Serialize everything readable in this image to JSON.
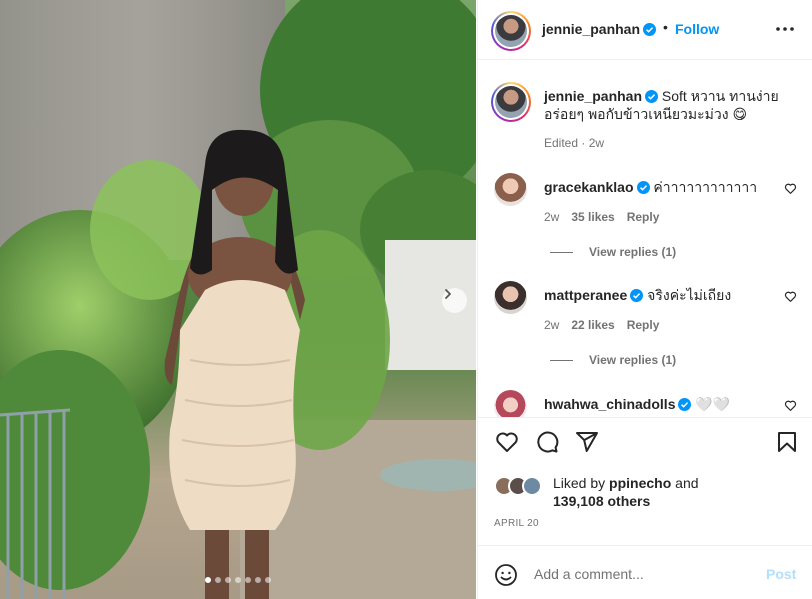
{
  "post": {
    "username": "jennie_panhan",
    "follow_label": "Follow",
    "separator": "•",
    "caption": "Soft หวาน ทานง่าย อร่อยๆ พอกับข้าวเหนียวมะม่วง 😋",
    "caption_meta": "Edited · 2w"
  },
  "comments": [
    {
      "username": "gracekanklao",
      "text": "ค่าาาาาาาาาาาา",
      "time": "2w",
      "likes": "35 likes",
      "reply": "Reply",
      "view_replies": "View replies (1)"
    },
    {
      "username": "mattperanee",
      "text": "จริงค่ะไม่เถียง",
      "time": "2w",
      "likes": "22 likes",
      "reply": "Reply",
      "view_replies": "View replies (1)"
    },
    {
      "username": "hwahwa_chinadolls",
      "text": "🤍🤍"
    }
  ],
  "likes": {
    "prefix": "Liked by ",
    "user": "ppinecho",
    "and": " and",
    "others": "139,108 others"
  },
  "date": "APRIL 20",
  "add_comment": {
    "placeholder": "Add a comment...",
    "post_label": "Post"
  },
  "carousel": {
    "slides": 7,
    "active": 1
  },
  "colors": {
    "accent": "#0095f6",
    "verified": "#0095f6",
    "post_disabled": "#b2dffc",
    "meta": "#737373"
  },
  "icons": [
    "verified-icon",
    "more-icon",
    "heart-icon",
    "comment-icon",
    "share-icon",
    "bookmark-icon",
    "emoji-icon",
    "chevron-right-icon"
  ]
}
